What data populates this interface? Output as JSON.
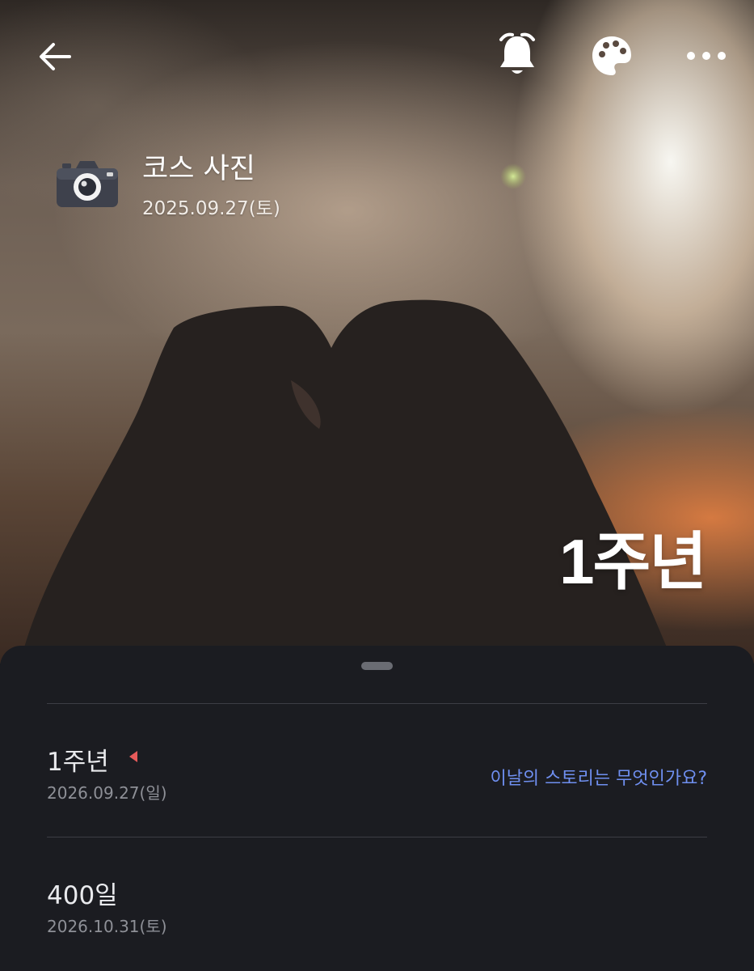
{
  "header": {
    "back_icon": "arrow-left-icon",
    "actions": [
      "bell-icon",
      "palette-icon",
      "more-horizontal-icon"
    ]
  },
  "photo_card": {
    "icon": "camera-icon",
    "title": "코스 사진",
    "date": "2025.09.27(토)"
  },
  "hero": {
    "badge": "1주년"
  },
  "sheet": {
    "items": [
      {
        "title": "1주년",
        "date": "2026.09.27(일)",
        "flag_icon": "red-flag-icon",
        "link": "이날의 스토리는 무엇인가요?"
      },
      {
        "title": "400일",
        "date": "2026.10.31(토)"
      }
    ]
  },
  "colors": {
    "sheet_background": "#1b1c21",
    "link": "#6f8ff0",
    "flag": "#e65a5a"
  }
}
